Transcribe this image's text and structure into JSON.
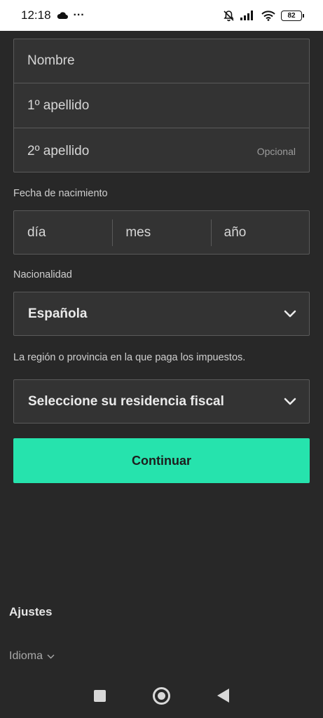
{
  "status_bar": {
    "time": "12:18",
    "more": "···",
    "battery": "82",
    "icons": [
      "cloud-icon",
      "bell-off-icon",
      "signal-icon",
      "wifi-icon",
      "battery-icon"
    ]
  },
  "form": {
    "nombre_placeholder": "Nombre",
    "apellido1_placeholder": "1º apellido",
    "apellido2_placeholder": "2º apellido",
    "opcional": "Opcional",
    "fecha_label": "Fecha de nacimiento",
    "dia_placeholder": "día",
    "mes_placeholder": "mes",
    "ano_placeholder": "año",
    "nacionalidad_label": "Nacionalidad",
    "nacionalidad_value": "Española",
    "region_label": "La región o provincia en la que paga los impuestos.",
    "residencia_value": "Seleccione su residencia fiscal",
    "continuar": "Continuar"
  },
  "footer": {
    "ajustes": "Ajustes",
    "idioma": "Idioma"
  },
  "colors": {
    "background": "#282828",
    "field_bg": "#333333",
    "accent": "#26e3ad"
  }
}
